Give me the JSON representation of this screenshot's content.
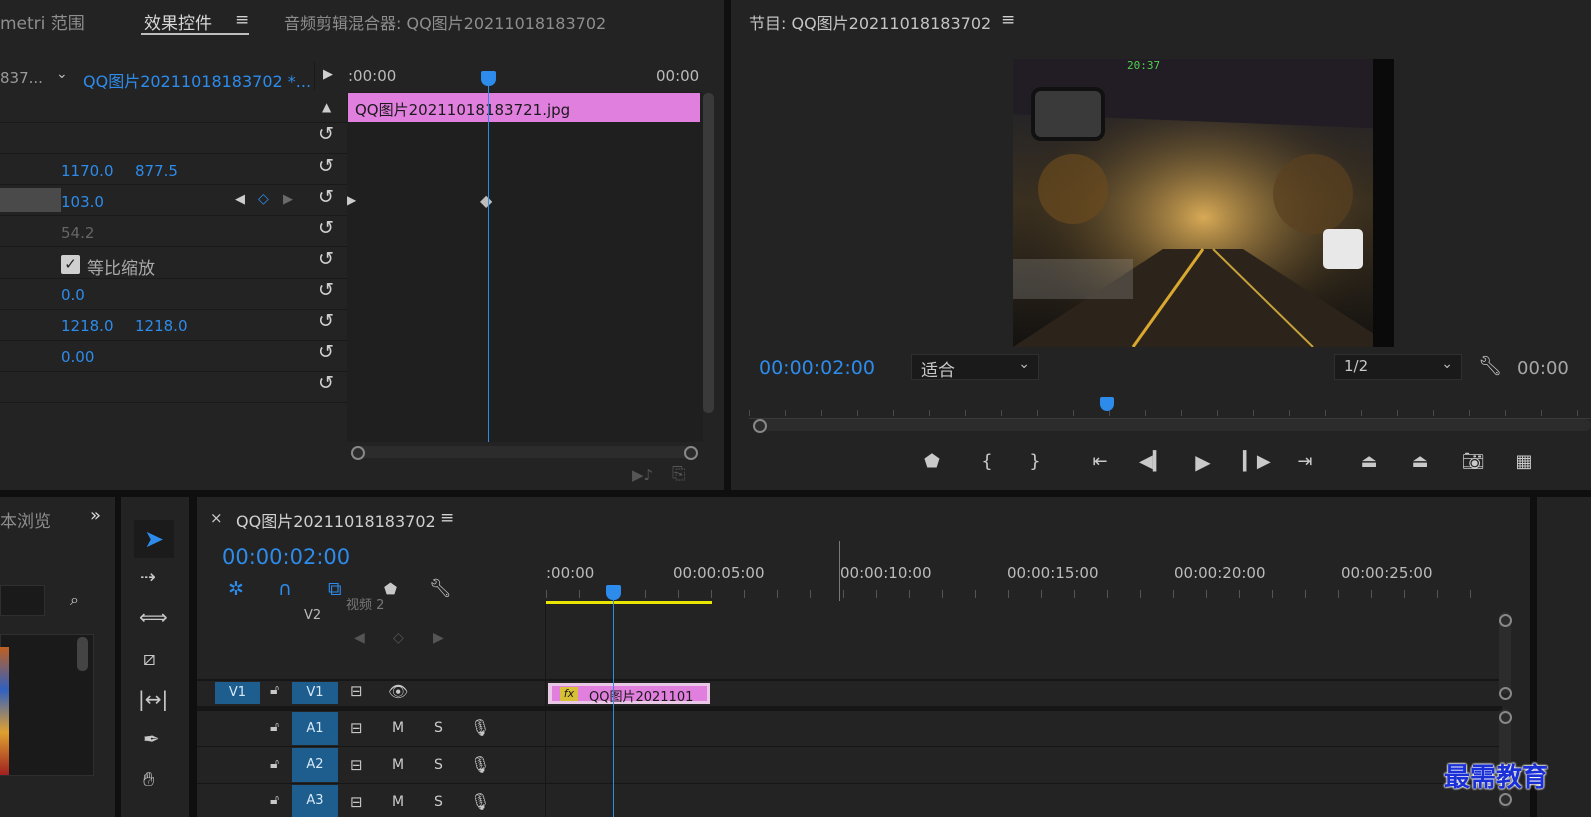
{
  "effect_controls": {
    "tabs": {
      "lumetri": "metri 范围",
      "effects": "效果控件",
      "mixer": "音频剪辑混合器: QQ图片20211018183702"
    },
    "source_label": "837...",
    "sequence_label": "QQ图片20211018183702 *...",
    "timeline_start": ":00:00",
    "timeline_end": "00:00",
    "clip_name": "QQ图片20211018183721.jpg",
    "position": {
      "x": "1170.0",
      "y": "877.5"
    },
    "scale": "103.0",
    "scale_width": "54.2",
    "uniform_scale_label": "等比缩放",
    "rotation": "0.0",
    "anchor": {
      "x": "1218.0",
      "y": "1218.0"
    },
    "anti_flicker": "0.00"
  },
  "program_monitor": {
    "title": "节目: QQ图片20211018183702",
    "timecode": "00:00:02:00",
    "fit_label": "适合",
    "resolution": "1/2",
    "end_timecode": "00:00",
    "dash_clock": "20:37"
  },
  "project_panel": {
    "title": "本浏览"
  },
  "timeline": {
    "sequence_name": "QQ图片20211018183702",
    "timecode": "00:00:02:00",
    "ruler": [
      ":00:00",
      "00:00:05:00",
      "00:00:10:00",
      "00:00:15:00",
      "00:00:20:00",
      "00:00:25:00"
    ],
    "tracks": {
      "v2": "V2",
      "v2_name": "视频 2",
      "v1_source": "V1",
      "v1": "V1",
      "a1": "A1",
      "a2": "A2",
      "a3": "A3",
      "mute": "M",
      "solo": "S"
    },
    "clip_label": "QQ图片2021101",
    "fx_badge": "fx"
  },
  "watermark": "最需教育",
  "colors": {
    "accent": "#2d8ceb",
    "clip_pink": "#e17fdf",
    "panel": "#232323",
    "yellow": "#e8e600"
  }
}
